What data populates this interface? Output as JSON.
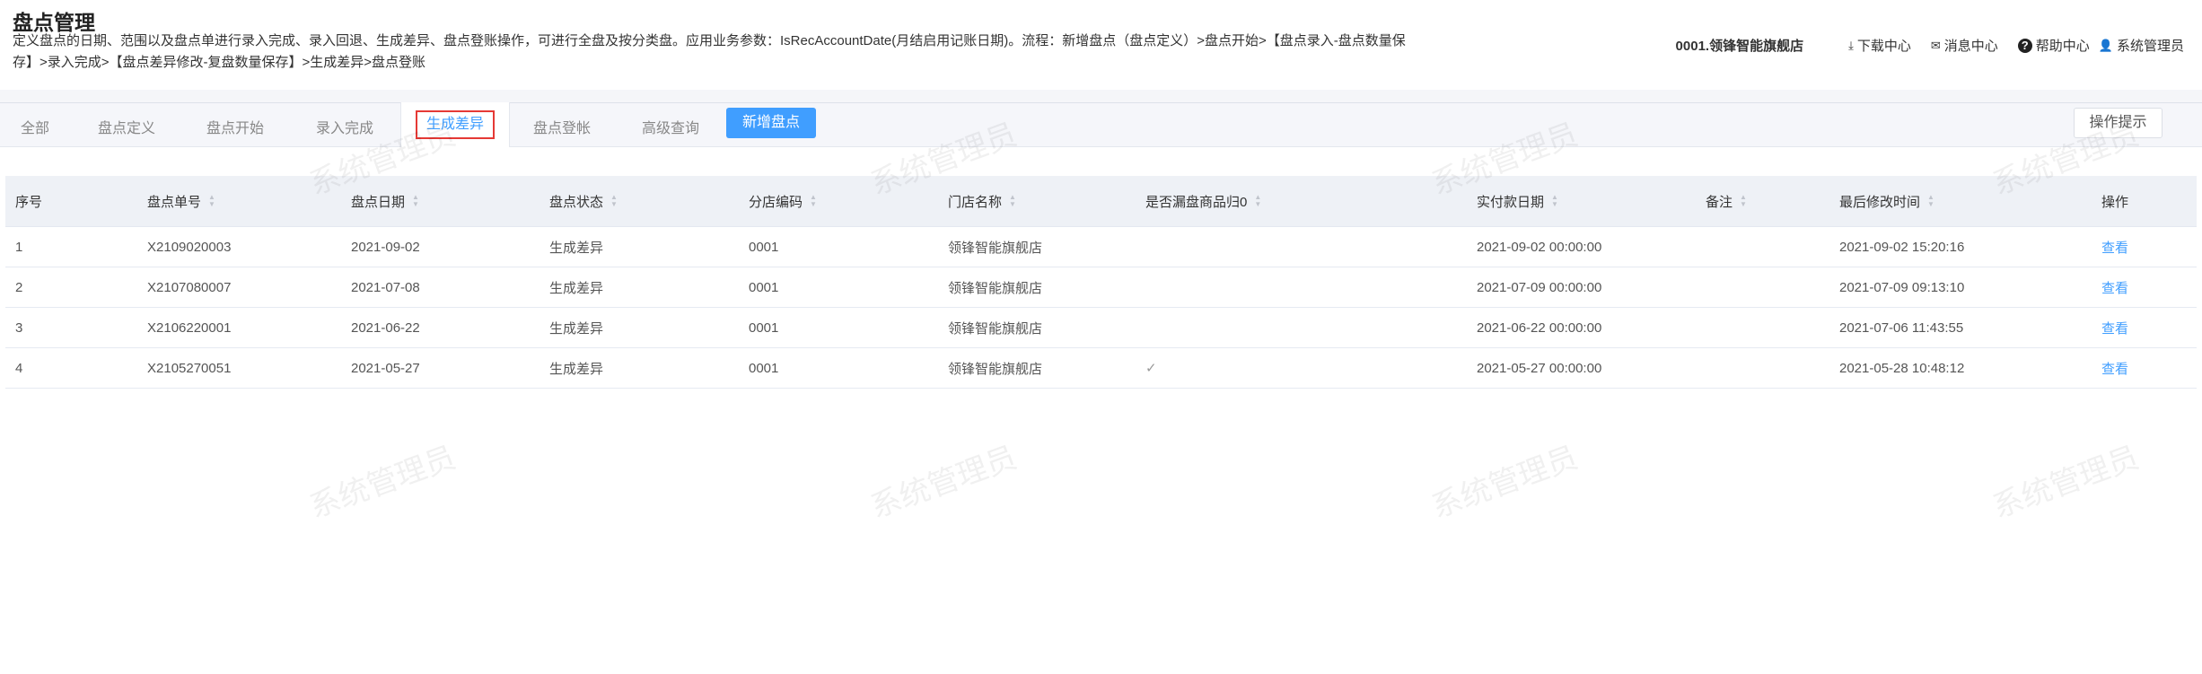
{
  "page": {
    "title": "盘点管理",
    "description": "定义盘点的日期、范围以及盘点单进行录入完成、录入回退、生成差异、盘点登账操作，可进行全盘及按分类盘。应用业务参数：IsRecAccountDate(月结启用记账日期)。流程：新增盘点（盘点定义）>盘点开始>【盘点录入-盘点数量保存】>录入完成>【盘点差异修改-复盘数量保存】>生成差异>盘点登账"
  },
  "topbar": {
    "store": "0001.领锋智能旗舰店",
    "download": "下载中心",
    "messages": "消息中心",
    "help": "帮助中心",
    "user": "系统管理员"
  },
  "tabs": [
    "全部",
    "盘点定义",
    "盘点开始",
    "录入完成",
    "生成差异",
    "盘点登帐",
    "高级查询"
  ],
  "active_tab": "生成差异",
  "buttons": {
    "add": "新增盘点",
    "tips": "操作提示"
  },
  "table": {
    "columns": [
      "序号",
      "盘点单号",
      "盘点日期",
      "盘点状态",
      "分店编码",
      "门店名称",
      "是否漏盘商品归0",
      "实付款日期",
      "备注",
      "最后修改时间",
      "操作"
    ],
    "rows": [
      [
        "1",
        "X2109020003",
        "2021-09-02",
        "生成差异",
        "0001",
        "领锋智能旗舰店",
        "",
        "2021-09-02 00:00:00",
        "",
        "2021-09-02 15:20:16",
        "查看"
      ],
      [
        "2",
        "X2107080007",
        "2021-07-08",
        "生成差异",
        "0001",
        "领锋智能旗舰店",
        "",
        "2021-07-09 00:00:00",
        "",
        "2021-07-09 09:13:10",
        "查看"
      ],
      [
        "3",
        "X2106220001",
        "2021-06-22",
        "生成差异",
        "0001",
        "领锋智能旗舰店",
        "",
        "2021-06-22 00:00:00",
        "",
        "2021-07-06 11:43:55",
        "查看"
      ],
      [
        "4",
        "X2105270051",
        "2021-05-27",
        "生成差异",
        "0001",
        "领锋智能旗舰店",
        "✓",
        "2021-05-27 00:00:00",
        "",
        "2021-05-28 10:48:12",
        "查看"
      ]
    ]
  },
  "watermark": "系统管理员",
  "colors": {
    "accent": "#409eff",
    "highlight": "#e53935"
  }
}
